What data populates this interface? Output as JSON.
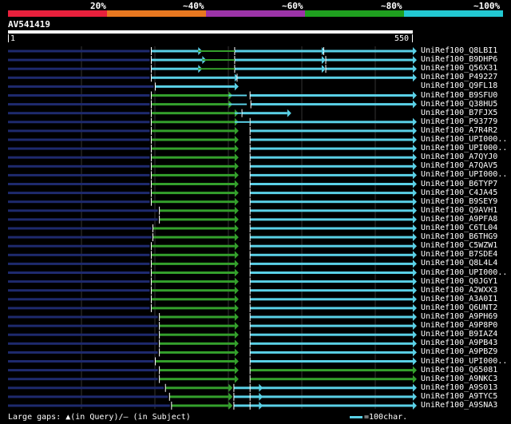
{
  "legend": {
    "labels": [
      "20%",
      "~40%",
      "~60%",
      "~80%",
      "~100%"
    ],
    "colors": [
      "#e8203c",
      "#e87820",
      "#9c34a8",
      "#1fa01f",
      "#22c8d2"
    ]
  },
  "query": {
    "id": "AV541419",
    "start": "1",
    "end": "550",
    "length": 550
  },
  "colors": {
    "cyan": "#5ad0e6",
    "green": "#34a02c",
    "navy": "#1e2a6e",
    "grid": "#333333"
  },
  "hits": [
    {
      "name": "UniRef100_Q8LBI1",
      "segs": [
        [
          0,
          350,
          "n"
        ],
        [
          354,
          470,
          "c"
        ],
        [
          560,
          775,
          "c"
        ],
        [
          780,
          1000,
          "c"
        ]
      ],
      "gaps": [
        [
          470,
          560,
          "g"
        ],
        [
          775,
          780,
          "c"
        ]
      ]
    },
    {
      "name": "UniRef100_B9DHP6",
      "segs": [
        [
          0,
          350,
          "n"
        ],
        [
          354,
          480,
          "c"
        ],
        [
          560,
          775,
          "c"
        ],
        [
          785,
          1000,
          "c"
        ]
      ],
      "gaps": [
        [
          480,
          560,
          "g"
        ]
      ]
    },
    {
      "name": "UniRef100_Q56X31",
      "segs": [
        [
          0,
          350,
          "n"
        ],
        [
          354,
          470,
          "c"
        ],
        [
          560,
          775,
          "c"
        ],
        [
          785,
          1000,
          "c"
        ]
      ],
      "gaps": [
        [
          470,
          560,
          "g"
        ]
      ]
    },
    {
      "name": "UniRef100_P49227",
      "segs": [
        [
          0,
          350,
          "n"
        ],
        [
          354,
          560,
          "c"
        ],
        [
          566,
          1000,
          "c"
        ]
      ],
      "gaps": []
    },
    {
      "name": "UniRef100_Q9FL18",
      "segs": [
        [
          0,
          360,
          "n"
        ],
        [
          364,
          560,
          "c"
        ]
      ],
      "gaps": []
    },
    {
      "name": "UniRef100_B9SFU0",
      "segs": [
        [
          0,
          350,
          "n"
        ],
        [
          354,
          545,
          "g"
        ],
        [
          598,
          1000,
          "c"
        ]
      ],
      "gaps": [
        [
          545,
          590,
          "c"
        ]
      ]
    },
    {
      "name": "UniRef100_Q38HU5",
      "segs": [
        [
          0,
          350,
          "n"
        ],
        [
          354,
          545,
          "g"
        ],
        [
          600,
          1000,
          "c"
        ]
      ],
      "gaps": [
        [
          545,
          590,
          "c"
        ]
      ]
    },
    {
      "name": "UniRef100_B7FJX5",
      "segs": [
        [
          0,
          350,
          "n"
        ],
        [
          354,
          560,
          "g"
        ],
        [
          578,
          690,
          "c"
        ]
      ],
      "gaps": [
        [
          560,
          578,
          "c"
        ]
      ]
    },
    {
      "name": "UniRef100_P93779",
      "segs": [
        [
          0,
          350,
          "n"
        ],
        [
          354,
          560,
          "g"
        ],
        [
          598,
          1000,
          "c"
        ]
      ],
      "gaps": [
        [
          560,
          598,
          "c"
        ]
      ]
    },
    {
      "name": "UniRef100_A7R4R2",
      "segs": [
        [
          0,
          350,
          "n"
        ],
        [
          354,
          560,
          "g"
        ],
        [
          598,
          1000,
          "c"
        ]
      ],
      "gaps": []
    },
    {
      "name": "UniRef100_UPI000..",
      "segs": [
        [
          0,
          350,
          "n"
        ],
        [
          354,
          560,
          "g"
        ],
        [
          598,
          1000,
          "c"
        ]
      ],
      "gaps": []
    },
    {
      "name": "UniRef100_UPI000..",
      "segs": [
        [
          0,
          350,
          "n"
        ],
        [
          354,
          560,
          "g"
        ],
        [
          598,
          1000,
          "c"
        ]
      ],
      "gaps": []
    },
    {
      "name": "UniRef100_A7QYJ0",
      "segs": [
        [
          0,
          350,
          "n"
        ],
        [
          354,
          560,
          "g"
        ],
        [
          598,
          1000,
          "c"
        ]
      ],
      "gaps": []
    },
    {
      "name": "UniRef100_A7QAV5",
      "segs": [
        [
          0,
          350,
          "n"
        ],
        [
          354,
          560,
          "g"
        ],
        [
          598,
          1000,
          "c"
        ]
      ],
      "gaps": []
    },
    {
      "name": "UniRef100_UPI000..",
      "segs": [
        [
          0,
          350,
          "n"
        ],
        [
          354,
          560,
          "g"
        ],
        [
          598,
          1000,
          "c"
        ]
      ],
      "gaps": []
    },
    {
      "name": "UniRef100_B6TYP7",
      "segs": [
        [
          0,
          350,
          "n"
        ],
        [
          354,
          560,
          "g"
        ],
        [
          598,
          1000,
          "c"
        ]
      ],
      "gaps": []
    },
    {
      "name": "UniRef100_C4JA45",
      "segs": [
        [
          0,
          350,
          "n"
        ],
        [
          354,
          560,
          "g"
        ],
        [
          598,
          1000,
          "c"
        ]
      ],
      "gaps": []
    },
    {
      "name": "UniRef100_B9SEY9",
      "segs": [
        [
          0,
          350,
          "n"
        ],
        [
          354,
          560,
          "g"
        ],
        [
          598,
          1000,
          "c"
        ]
      ],
      "gaps": []
    },
    {
      "name": "UniRef100_Q9AVH1",
      "segs": [
        [
          0,
          370,
          "n"
        ],
        [
          374,
          560,
          "g"
        ],
        [
          598,
          1000,
          "c"
        ]
      ],
      "gaps": []
    },
    {
      "name": "UniRef100_A9PFA8",
      "segs": [
        [
          0,
          370,
          "n"
        ],
        [
          374,
          560,
          "g"
        ],
        [
          598,
          1000,
          "c"
        ]
      ],
      "gaps": []
    },
    {
      "name": "UniRef100_C6TL04",
      "segs": [
        [
          0,
          355,
          "n"
        ],
        [
          358,
          560,
          "g"
        ],
        [
          598,
          1000,
          "c"
        ]
      ],
      "gaps": []
    },
    {
      "name": "UniRef100_B6THG9",
      "segs": [
        [
          0,
          355,
          "n"
        ],
        [
          358,
          560,
          "g"
        ],
        [
          598,
          1000,
          "c"
        ]
      ],
      "gaps": []
    },
    {
      "name": "UniRef100_C5WZW1",
      "segs": [
        [
          0,
          350,
          "n"
        ],
        [
          354,
          560,
          "g"
        ],
        [
          598,
          1000,
          "c"
        ]
      ],
      "gaps": []
    },
    {
      "name": "UniRef100_B7SDE4",
      "segs": [
        [
          0,
          350,
          "n"
        ],
        [
          354,
          560,
          "g"
        ],
        [
          598,
          1000,
          "c"
        ]
      ],
      "gaps": []
    },
    {
      "name": "UniRef100_Q8L4L4",
      "segs": [
        [
          0,
          350,
          "n"
        ],
        [
          354,
          560,
          "g"
        ],
        [
          598,
          1000,
          "c"
        ]
      ],
      "gaps": []
    },
    {
      "name": "UniRef100_UPI000..",
      "segs": [
        [
          0,
          350,
          "n"
        ],
        [
          354,
          560,
          "g"
        ],
        [
          598,
          1000,
          "c"
        ]
      ],
      "gaps": []
    },
    {
      "name": "UniRef100_Q0JGY1",
      "segs": [
        [
          0,
          350,
          "n"
        ],
        [
          354,
          560,
          "g"
        ],
        [
          598,
          1000,
          "c"
        ]
      ],
      "gaps": []
    },
    {
      "name": "UniRef100_A2WXX3",
      "segs": [
        [
          0,
          350,
          "n"
        ],
        [
          354,
          560,
          "g"
        ],
        [
          598,
          1000,
          "c"
        ]
      ],
      "gaps": []
    },
    {
      "name": "UniRef100_A3A0I1",
      "segs": [
        [
          0,
          350,
          "n"
        ],
        [
          354,
          560,
          "g"
        ],
        [
          598,
          1000,
          "c"
        ]
      ],
      "gaps": []
    },
    {
      "name": "UniRef100_Q6UNT2",
      "segs": [
        [
          0,
          350,
          "n"
        ],
        [
          354,
          560,
          "g"
        ],
        [
          598,
          1000,
          "c"
        ]
      ],
      "gaps": []
    },
    {
      "name": "UniRef100_A9PH69",
      "segs": [
        [
          0,
          370,
          "n"
        ],
        [
          374,
          560,
          "g"
        ],
        [
          598,
          1000,
          "c"
        ]
      ],
      "gaps": []
    },
    {
      "name": "UniRef100_A9P8P0",
      "segs": [
        [
          0,
          370,
          "n"
        ],
        [
          374,
          560,
          "g"
        ],
        [
          598,
          1000,
          "c"
        ]
      ],
      "gaps": []
    },
    {
      "name": "UniRef100_B9IAZ4",
      "segs": [
        [
          0,
          370,
          "n"
        ],
        [
          374,
          560,
          "g"
        ],
        [
          598,
          1000,
          "c"
        ]
      ],
      "gaps": []
    },
    {
      "name": "UniRef100_A9PB43",
      "segs": [
        [
          0,
          370,
          "n"
        ],
        [
          374,
          560,
          "g"
        ],
        [
          598,
          1000,
          "c"
        ]
      ],
      "gaps": []
    },
    {
      "name": "UniRef100_A9PBZ9",
      "segs": [
        [
          0,
          370,
          "n"
        ],
        [
          374,
          560,
          "g"
        ],
        [
          598,
          1000,
          "c"
        ]
      ],
      "gaps": []
    },
    {
      "name": "UniRef100_UPI000..",
      "segs": [
        [
          0,
          360,
          "n"
        ],
        [
          364,
          560,
          "g"
        ],
        [
          598,
          1000,
          "c"
        ]
      ],
      "gaps": []
    },
    {
      "name": "UniRef100_Q65081",
      "segs": [
        [
          0,
          370,
          "n"
        ],
        [
          374,
          560,
          "g"
        ],
        [
          598,
          1000,
          "g"
        ]
      ],
      "gaps": []
    },
    {
      "name": "UniRef100_A9NKC3",
      "segs": [
        [
          0,
          370,
          "n"
        ],
        [
          374,
          560,
          "g"
        ],
        [
          598,
          1000,
          "g"
        ]
      ],
      "gaps": []
    },
    {
      "name": "UniRef100_A9S013",
      "segs": [
        [
          0,
          385,
          "n"
        ],
        [
          389,
          545,
          "g"
        ],
        [
          558,
          620,
          "c"
        ],
        [
          598,
          1000,
          "c"
        ]
      ],
      "gaps": []
    },
    {
      "name": "UniRef100_A9TYC5",
      "segs": [
        [
          0,
          395,
          "n"
        ],
        [
          399,
          545,
          "g"
        ],
        [
          558,
          620,
          "c"
        ],
        [
          598,
          1000,
          "c"
        ]
      ],
      "gaps": []
    },
    {
      "name": "UniRef100_A9SNA3",
      "segs": [
        [
          0,
          400,
          "n"
        ],
        [
          404,
          545,
          "g"
        ],
        [
          558,
          620,
          "c"
        ],
        [
          598,
          1000,
          "c"
        ]
      ],
      "gaps": []
    }
  ],
  "footer": {
    "gaps_text": "Large gaps: ▲(in Query)/– (in Subject)",
    "scale_text": "=100char."
  }
}
